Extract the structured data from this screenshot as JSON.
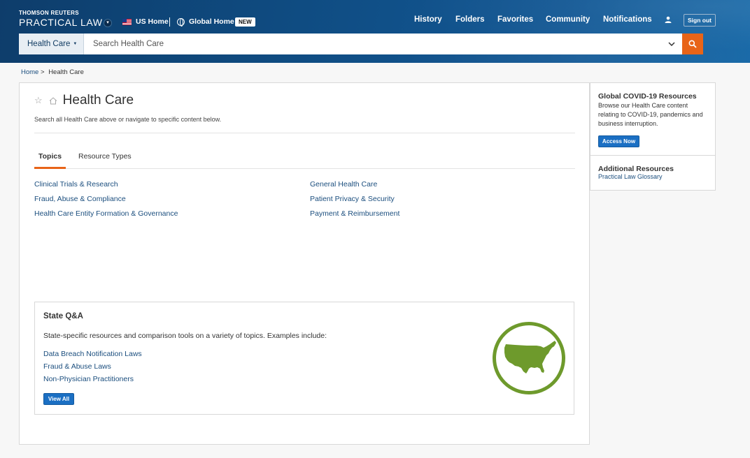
{
  "header": {
    "brand_top": "THOMSON REUTERS",
    "brand_main": "PRACTICAL LAW",
    "us_home": "US Home",
    "global_home": "Global Home",
    "new_badge": "NEW",
    "nav": [
      "History",
      "Folders",
      "Favorites",
      "Community",
      "Notifications"
    ],
    "sign_out": "Sign out"
  },
  "search": {
    "scope_label": "Health Care",
    "placeholder": "Search Health Care"
  },
  "breadcrumb": {
    "home": "Home",
    "separator": ">",
    "current": "Health Care"
  },
  "main": {
    "title": "Health Care",
    "subtitle": "Search all Health Care above or navigate to specific content below.",
    "tabs": [
      "Topics",
      "Resource Types"
    ],
    "topics_left": [
      "Clinical Trials & Research",
      "Fraud, Abuse & Compliance",
      "Health Care Entity Formation & Governance"
    ],
    "topics_right": [
      "General Health Care",
      "Patient Privacy & Security",
      "Payment & Reimbursement"
    ]
  },
  "state_qa": {
    "title": "State Q&A",
    "description": "State-specific resources and comparison tools on a variety of topics. Examples include:",
    "links": [
      "Data Breach Notification Laws",
      "Fraud & Abuse Laws",
      "Non-Physician Practitioners"
    ],
    "view_all": "View All"
  },
  "sidebar": {
    "covid_title": "Global COVID-19 Resources",
    "covid_text": "Browse our Health Care content relating to COVID-19, pandemics and business interruption.",
    "access_now": "Access Now",
    "additional_title": "Additional Resources",
    "glossary_link": "Practical Law Glossary"
  },
  "colors": {
    "header_blue": "#0f4c82",
    "accent_orange": "#e86418",
    "link_blue": "#1b4e7e",
    "button_blue": "#1b6fc3",
    "emblem_green": "#6e9a2c"
  }
}
